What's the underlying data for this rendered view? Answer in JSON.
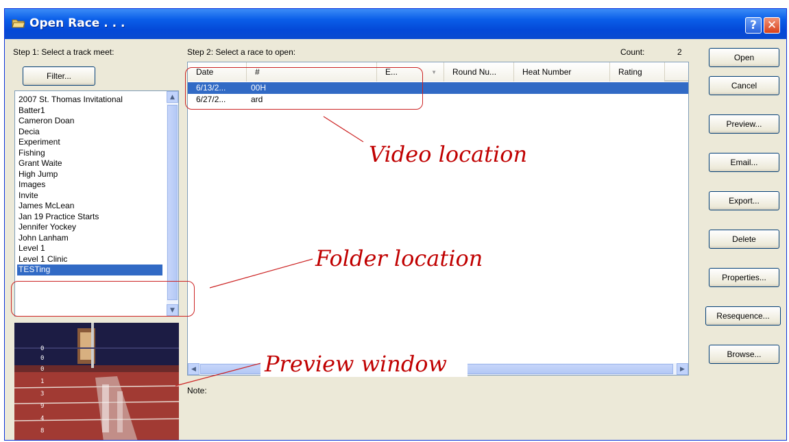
{
  "window": {
    "title": "Open Race . . .",
    "help_label": "?",
    "close_label": "✕"
  },
  "step1": {
    "label": "Step 1: Select a track meet:",
    "filter_label": "Filter...",
    "meets": [
      "2007 St. Thomas Invitational",
      "Batter1",
      "Cameron Doan",
      "Decia",
      "Experiment",
      "Fishing",
      "Grant Waite",
      "High Jump",
      "Images",
      "Invite",
      "James McLean",
      "Jan 19 Practice Starts",
      "Jennifer Yockey",
      "John Lanham",
      "Level 1",
      "Level 1 Clinic",
      "TESTing"
    ],
    "selected_meet": "TESTing"
  },
  "step2": {
    "label": "Step 2: Select a race to open:",
    "count_label": "Count:",
    "count_value": "2",
    "columns": [
      "Date",
      "#",
      "E...",
      "Round Nu...",
      "Heat Number",
      "Rating"
    ],
    "rows": [
      {
        "date": "6/13/2...",
        "num": "00H",
        "selected": true
      },
      {
        "date": "6/27/2...",
        "num": "ard",
        "selected": false
      }
    ],
    "note_label": "Note:"
  },
  "buttons": {
    "open": "Open",
    "cancel": "Cancel",
    "preview": "Preview...",
    "email": "Email...",
    "export": "Export...",
    "delete": "Delete",
    "properties": "Properties...",
    "resequence": "Resequence...",
    "browse": "Browse..."
  },
  "annotations": {
    "video": "Video location",
    "folder": "Folder location",
    "preview": "Preview window",
    "color": "#c00000"
  },
  "icons": {
    "title": "folder-open-icon",
    "scroll_up": "arrow-up-icon",
    "scroll_down": "arrow-down-icon",
    "scroll_left": "arrow-left-icon",
    "scroll_right": "arrow-right-icon"
  },
  "colors": {
    "titlebar": "#0a5ee8",
    "selection": "#316ac5",
    "dialog": "#ece9d8"
  }
}
